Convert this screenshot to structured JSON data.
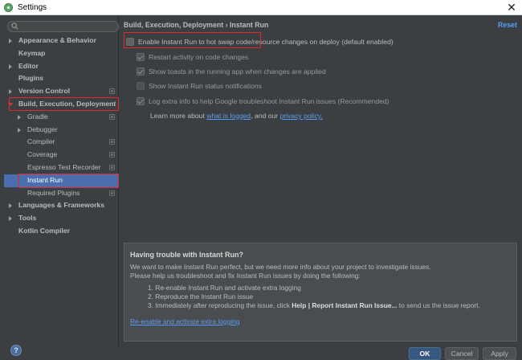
{
  "window": {
    "title": "Settings"
  },
  "search": {
    "placeholder": "",
    "value": ""
  },
  "sidebar": {
    "items": [
      {
        "label": "Appearance & Behavior",
        "bold": true,
        "arrow": "right",
        "indent": 0
      },
      {
        "label": "Keymap",
        "bold": true,
        "arrow": "",
        "indent": 0
      },
      {
        "label": "Editor",
        "bold": true,
        "arrow": "right",
        "indent": 0
      },
      {
        "label": "Plugins",
        "bold": true,
        "arrow": "",
        "indent": 0
      },
      {
        "label": "Version Control",
        "bold": true,
        "arrow": "right",
        "indent": 0,
        "icon": true
      },
      {
        "label": "Build, Execution, Deployment",
        "bold": true,
        "arrow": "down",
        "indent": 0
      },
      {
        "label": "Gradle",
        "bold": false,
        "arrow": "right",
        "indent": 1,
        "icon": true
      },
      {
        "label": "Debugger",
        "bold": false,
        "arrow": "right",
        "indent": 1
      },
      {
        "label": "Compiler",
        "bold": false,
        "arrow": "",
        "indent": 1,
        "icon": true
      },
      {
        "label": "Coverage",
        "bold": false,
        "arrow": "",
        "indent": 1,
        "icon": true
      },
      {
        "label": "Espresso Test Recorder",
        "bold": false,
        "arrow": "",
        "indent": 1,
        "icon": true
      },
      {
        "label": "Instant Run",
        "bold": false,
        "arrow": "",
        "indent": 1,
        "selected": true
      },
      {
        "label": "Required Plugins",
        "bold": false,
        "arrow": "",
        "indent": 1,
        "icon": true
      },
      {
        "label": "Languages & Frameworks",
        "bold": true,
        "arrow": "right",
        "indent": 0
      },
      {
        "label": "Tools",
        "bold": true,
        "arrow": "right",
        "indent": 0
      },
      {
        "label": "Kotlin Compiler",
        "bold": true,
        "arrow": "",
        "indent": 0
      }
    ]
  },
  "main": {
    "breadcrumb": "Build, Execution, Deployment › Instant Run",
    "reset": "Reset",
    "options": [
      {
        "label": "Enable Instant Run to hot swap code/resource changes on deploy (default enabled)",
        "checked": false
      },
      {
        "label": "Restart activity on code changes",
        "checked": true
      },
      {
        "label": "Show toasts in the running app when changes are applied",
        "checked": true
      },
      {
        "label": "Show Instant Run status notifications",
        "checked": false
      },
      {
        "label": "Log extra info to help Google troubleshoot Instant Run issues (Recommended)",
        "checked": true
      }
    ],
    "learn": {
      "prefix": "Learn more about ",
      "link1": "what is logged",
      "middle": ", and our ",
      "link2": "privacy policy."
    }
  },
  "help_box": {
    "title": "Having trouble with Instant Run?",
    "line1": "We want to make Instant Run perfect, but we need more info about your project to investigate issues.",
    "line2": "Please help us troubleshoot and fix Instant Run issues by doing the following:",
    "step1": "1. Re-enable Instant Run and activate extra logging",
    "step2": "2. Reproduce the Instant Run issue",
    "step3_prefix": "3. Immediately after reproducing the issue, click ",
    "step3_bold": "Help | Report Instant Run Issue...",
    "step3_suffix": " to send us the issue report.",
    "link": "Re-enable and activate extra logging"
  },
  "buttons": {
    "help": "?",
    "ok": "OK",
    "cancel": "Cancel",
    "apply": "Apply"
  }
}
